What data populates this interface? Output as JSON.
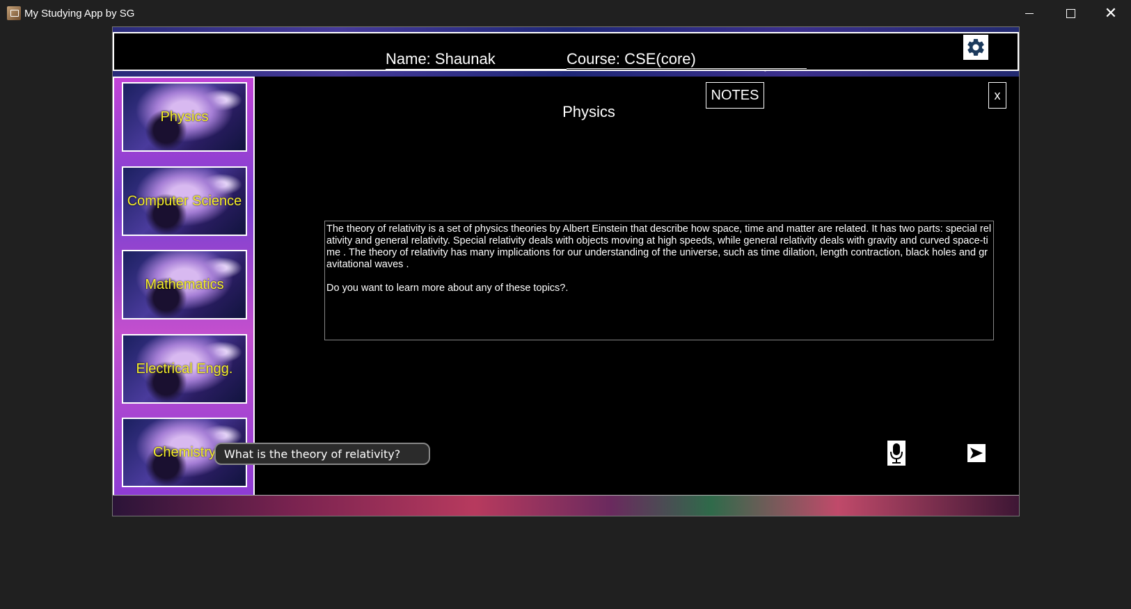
{
  "window": {
    "title": "My Studying App by SG",
    "minimize_icon": "minimize-icon",
    "maximize_icon": "maximize-icon",
    "close_icon": "close-icon",
    "close_glyph": "✕"
  },
  "header": {
    "name_label": "Name: Shaunak",
    "course_label": "Course: CSE(core)",
    "settings_icon": "gear-icon"
  },
  "sidebar": {
    "subjects": [
      {
        "label": "Physics"
      },
      {
        "label": "Computer Science"
      },
      {
        "label": "Mathematics"
      },
      {
        "label": "Electrical Engg."
      },
      {
        "label": "Chemistry"
      }
    ]
  },
  "main": {
    "title": "Physics",
    "notes_label": "NOTES",
    "close_label": "x",
    "response_text": "The theory of relativity is a set of physics theories by Albert Einstein that describe how space, time and matter are related. It has two parts: special relativity and general relativity. Special relativity deals with objects moving at high speeds, while general relativity deals with gravity and curved space-time . The theory of relativity has many implications for our understanding of the universe, such as time dilation, length contraction, black holes and gravitational waves .\n\nDo you want to learn more about any of these topics?.",
    "query_value": "What is the theory of relativity?",
    "mic_icon": "microphone-icon",
    "send_icon": "send-icon"
  },
  "colors": {
    "subject_label": "#f5ee2a",
    "background": "#202020"
  }
}
